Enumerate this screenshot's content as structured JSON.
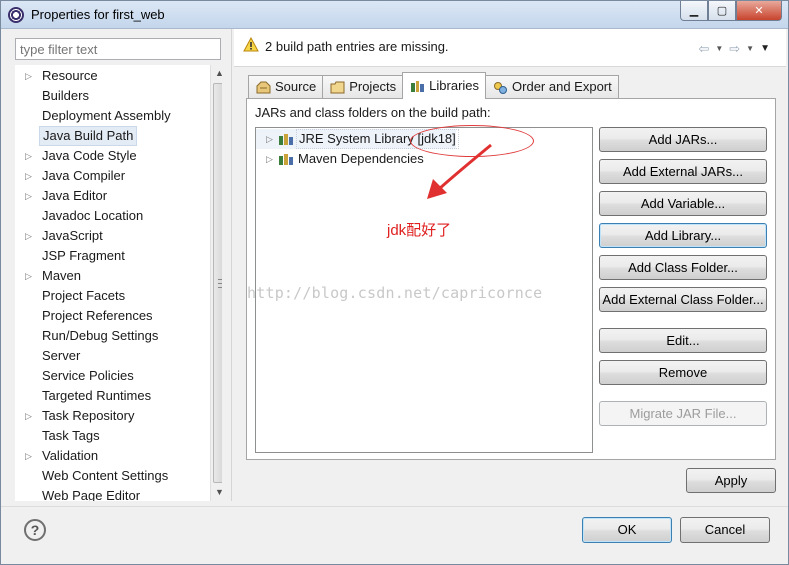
{
  "window": {
    "title": "Properties for first_web",
    "min_label": "▁",
    "max_label": "▢",
    "close_label": "✕"
  },
  "filter": {
    "placeholder": "type filter text"
  },
  "tree": {
    "items": [
      {
        "label": "Resource",
        "expandable": true
      },
      {
        "label": "Builders",
        "expandable": false
      },
      {
        "label": "Deployment Assembly",
        "expandable": false
      },
      {
        "label": "Java Build Path",
        "expandable": false,
        "selected": true
      },
      {
        "label": "Java Code Style",
        "expandable": true
      },
      {
        "label": "Java Compiler",
        "expandable": true
      },
      {
        "label": "Java Editor",
        "expandable": true
      },
      {
        "label": "Javadoc Location",
        "expandable": false
      },
      {
        "label": "JavaScript",
        "expandable": true
      },
      {
        "label": "JSP Fragment",
        "expandable": false
      },
      {
        "label": "Maven",
        "expandable": true
      },
      {
        "label": "Project Facets",
        "expandable": false
      },
      {
        "label": "Project References",
        "expandable": false
      },
      {
        "label": "Run/Debug Settings",
        "expandable": false
      },
      {
        "label": "Server",
        "expandable": false
      },
      {
        "label": "Service Policies",
        "expandable": false
      },
      {
        "label": "Targeted Runtimes",
        "expandable": false
      },
      {
        "label": "Task Repository",
        "expandable": true
      },
      {
        "label": "Task Tags",
        "expandable": false
      },
      {
        "label": "Validation",
        "expandable": true
      },
      {
        "label": "Web Content Settings",
        "expandable": false
      },
      {
        "label": "Web Page Editor",
        "expandable": false
      }
    ]
  },
  "message": {
    "text": "2 build path entries are missing."
  },
  "tabs": [
    {
      "label": "Source",
      "icon": "source-icon"
    },
    {
      "label": "Projects",
      "icon": "projects-icon"
    },
    {
      "label": "Libraries",
      "icon": "libraries-icon",
      "active": true
    },
    {
      "label": "Order and Export",
      "icon": "order-export-icon"
    }
  ],
  "libraries": {
    "heading": "JARs and class folders on the build path:",
    "entries": [
      {
        "label": "JRE System Library [jdk18]"
      },
      {
        "label": "Maven Dependencies"
      }
    ]
  },
  "buttons": {
    "add_jars": "Add JARs...",
    "add_external_jars": "Add External JARs...",
    "add_variable": "Add Variable...",
    "add_library": "Add Library...",
    "add_class_folder": "Add Class Folder...",
    "add_external_class_folder": "Add External Class Folder...",
    "edit": "Edit...",
    "remove": "Remove",
    "migrate_jar": "Migrate JAR File..."
  },
  "annotation": {
    "text": "jdk配好了"
  },
  "watermark": {
    "text": "http://blog.csdn.net/capricornce"
  },
  "footer": {
    "apply": "Apply",
    "ok": "OK",
    "cancel": "Cancel",
    "help_symbol": "?"
  },
  "colors": {
    "annotation": "#e02020",
    "selection": "#e3ebf5"
  }
}
